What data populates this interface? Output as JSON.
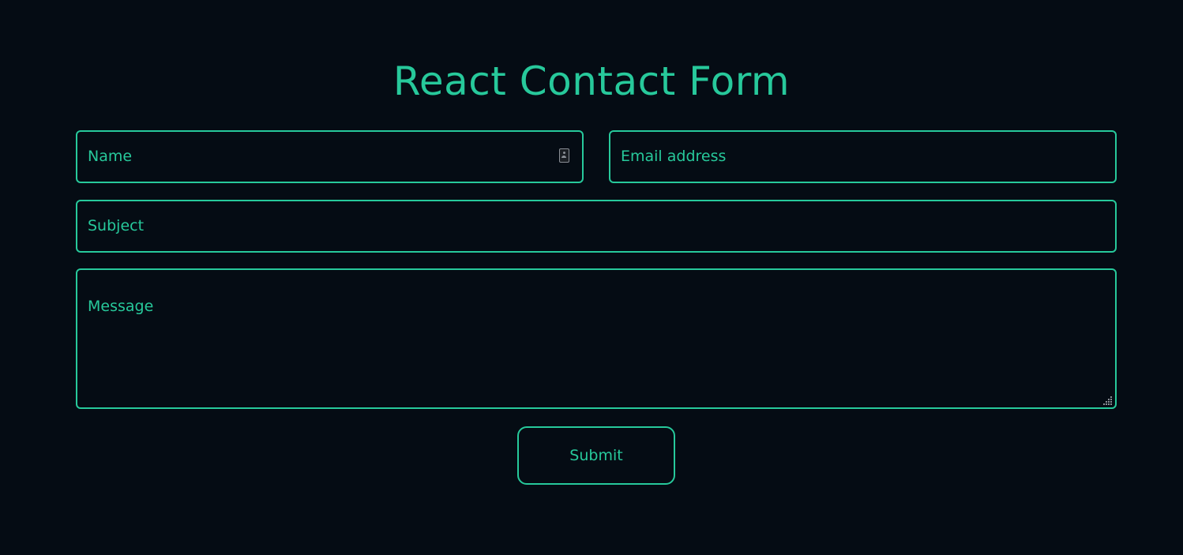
{
  "page": {
    "title": "React Contact Form"
  },
  "form": {
    "name_placeholder": "Name",
    "email_placeholder": "Email address",
    "subject_placeholder": "Subject",
    "message_placeholder": "Message",
    "submit_label": "Submit"
  },
  "icons": {
    "name_field_icon": "contact-card-icon",
    "message_resize": "resize-grip-icon"
  },
  "colors": {
    "background": "#050c14",
    "accent": "#27c99b",
    "icon_gray": "#8a8f96"
  }
}
